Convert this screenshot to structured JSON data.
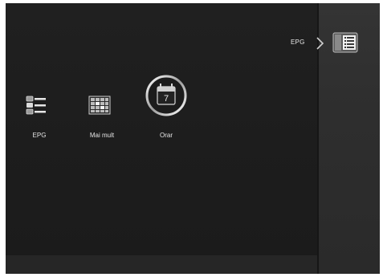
{
  "breadcrumb": {
    "label": "EPG",
    "icon": "epg-list-icon"
  },
  "menu": {
    "items": [
      {
        "label": "EPG",
        "icon": "epg-list-icon",
        "selected": false
      },
      {
        "label": "Mai mult",
        "icon": "grid-schedule-icon",
        "selected": false
      },
      {
        "label": "Orar",
        "icon": "calendar-icon",
        "selected": true
      }
    ]
  },
  "colors": {
    "background": "#1e1e1e",
    "side_panel": "#2e2e2e",
    "text": "#e4e4e4",
    "highlight_ring": "#ffffff"
  }
}
